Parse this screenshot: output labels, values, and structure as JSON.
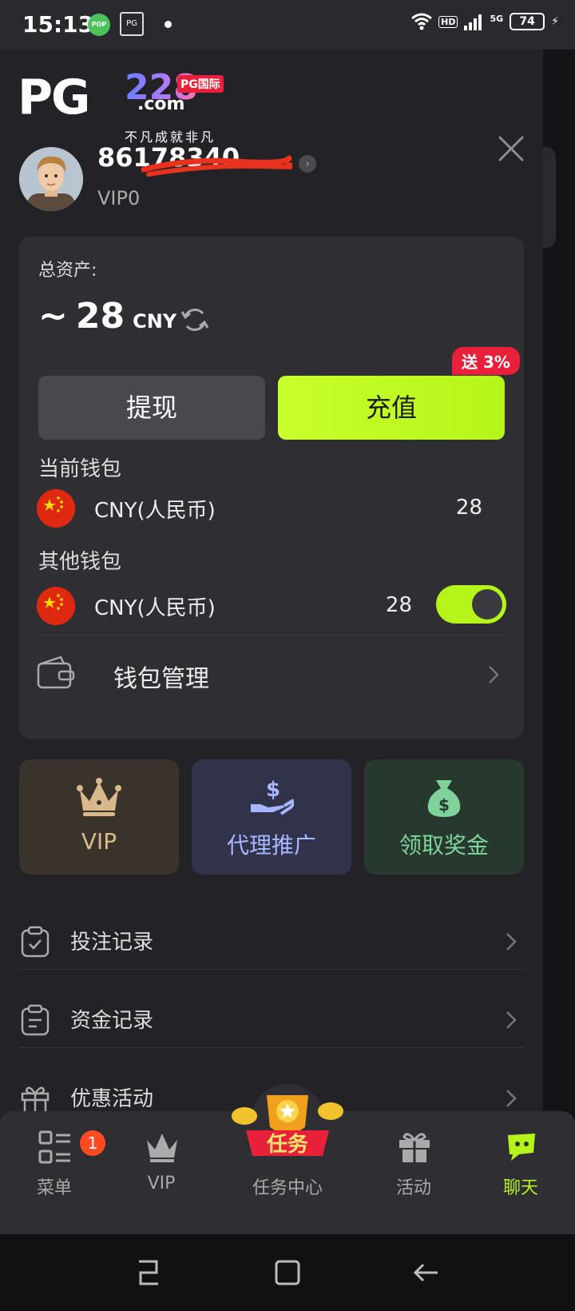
{
  "status_bar": {
    "time": "15:13",
    "pop_label": "POP",
    "pg_label": "PG",
    "network": "HD",
    "network_type": "5G",
    "battery": "74"
  },
  "drawer": {
    "logo": {
      "brand": "PG",
      "number": "228",
      "badge": "PG国际",
      "domain": ".com",
      "slogan": "不凡成就非凡"
    },
    "user": {
      "username": "86178340...",
      "vip_level": "VIP0"
    },
    "asset": {
      "label": "总资产:",
      "approx": "~",
      "amount": "28",
      "currency": "CNY",
      "withdraw_label": "提现",
      "deposit_label": "充值",
      "bonus_badge": "送 3%"
    },
    "current_wallet": {
      "title": "当前钱包",
      "name": "CNY(人民币)",
      "amount": "28"
    },
    "other_wallet": {
      "title": "其他钱包",
      "name": "CNY(人民币)",
      "amount": "28",
      "toggle_on": true
    },
    "wallet_mgmt_label": "钱包管理",
    "tiles": [
      {
        "label": "VIP",
        "icon": "crown-icon",
        "bg": "#3a332c",
        "color": "#d9b98c"
      },
      {
        "label": "代理推广",
        "icon": "hand-dollar-icon",
        "bg": "#30334a",
        "color": "#a8b6ff"
      },
      {
        "label": "领取奖金",
        "icon": "money-bag-icon",
        "bg": "#27392e",
        "color": "#7fd39a"
      }
    ],
    "menu": [
      {
        "label": "投注记录",
        "icon": "clipboard-check-icon"
      },
      {
        "label": "资金记录",
        "icon": "clipboard-list-icon"
      },
      {
        "label": "优惠活动",
        "icon": "gift-icon"
      }
    ]
  },
  "tabbar": {
    "tabs": [
      {
        "label": "菜单",
        "badge": "1",
        "icon": "menu-grid-icon"
      },
      {
        "label": "VIP",
        "icon": "crown-icon"
      },
      {
        "label": "任务中心",
        "icon": "task-trophy-icon",
        "overlay": "任务"
      },
      {
        "label": "活动",
        "icon": "gift-icon"
      },
      {
        "label": "聊天",
        "icon": "chat-icon"
      }
    ],
    "active_color": "#b6f51a"
  }
}
